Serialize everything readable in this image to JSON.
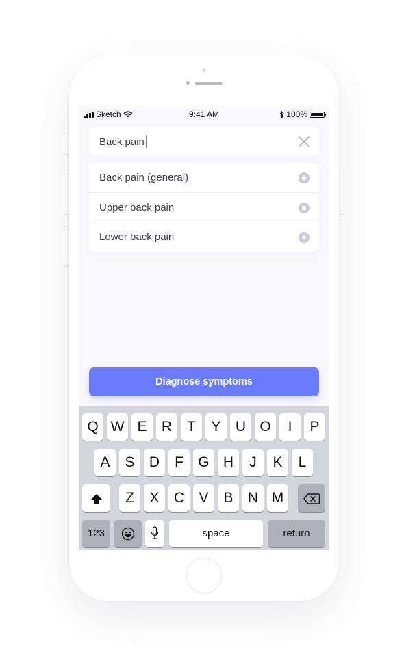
{
  "device": {
    "status_bar": {
      "carrier": "Sketch",
      "time": "9:41 AM",
      "battery": "100%"
    }
  },
  "search": {
    "value": "Back pain",
    "clear_icon": "close-icon"
  },
  "results": [
    {
      "label": "Back pain (general)",
      "icon": "add-circle-icon"
    },
    {
      "label": "Upper back pain",
      "icon": "add-circle-icon"
    },
    {
      "label": "Lower back pain",
      "icon": "add-circle-icon"
    }
  ],
  "actions": {
    "diagnose_label": "Diagnose symptoms"
  },
  "keyboard": {
    "row1": [
      "Q",
      "W",
      "E",
      "R",
      "T",
      "Y",
      "U",
      "O",
      "I",
      "P"
    ],
    "row2": [
      "A",
      "S",
      "D",
      "F",
      "G",
      "H",
      "J",
      "K",
      "L"
    ],
    "row3": [
      "Z",
      "X",
      "C",
      "V",
      "B",
      "N",
      "M"
    ],
    "numbers_label": "123",
    "space_label": "space",
    "return_label": "return"
  },
  "colors": {
    "accent": "#6b7bff",
    "screen_bg": "#f9f9fd",
    "text": "#3c3f4a",
    "icon_muted": "#c9cbd8"
  }
}
